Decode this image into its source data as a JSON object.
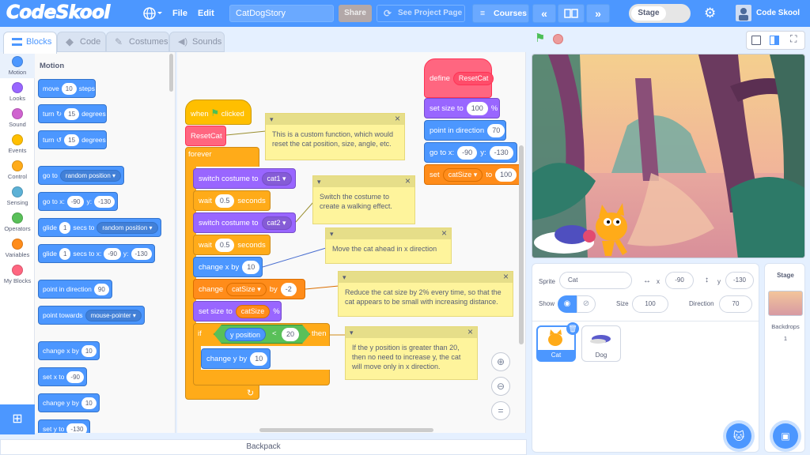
{
  "menubar": {
    "logo": "CodeSkool",
    "file": "File",
    "edit": "Edit",
    "project_title": "CatDogStory",
    "share": "Share",
    "see_project_page": "See Project Page",
    "courses": "Courses",
    "stage_toggle": "Stage",
    "user": "Code Skool"
  },
  "tabs": {
    "blocks": "Blocks",
    "code": "Code",
    "costumes": "Costumes",
    "sounds": "Sounds"
  },
  "categories": [
    {
      "label": "Motion",
      "color": "#4c97ff"
    },
    {
      "label": "Looks",
      "color": "#9966ff"
    },
    {
      "label": "Sound",
      "color": "#cf63cf"
    },
    {
      "label": "Events",
      "color": "#ffbf00"
    },
    {
      "label": "Control",
      "color": "#ffab19"
    },
    {
      "label": "Sensing",
      "color": "#5cb1d6"
    },
    {
      "label": "Operators",
      "color": "#59c059"
    },
    {
      "label": "Variables",
      "color": "#ff8c1a"
    },
    {
      "label": "My Blocks",
      "color": "#ff6680"
    }
  ],
  "palette": {
    "heading": "Motion",
    "move": {
      "a": "move",
      "v": "10",
      "b": "steps"
    },
    "turn_right": {
      "a": "turn",
      "v": "15",
      "b": "degrees"
    },
    "turn_left": {
      "a": "turn",
      "v": "15",
      "b": "degrees"
    },
    "goto": {
      "a": "go to",
      "v": "random position"
    },
    "goto_xy": {
      "a": "go to x:",
      "x": "-90",
      "b": "y:",
      "y": "-130"
    },
    "glide_to": {
      "a": "glide",
      "v": "1",
      "b": "secs to",
      "c": "random position"
    },
    "glide_xy": {
      "a": "glide",
      "v": "1",
      "b": "secs to x:",
      "x": "-90",
      "c": "y:",
      "y": "-130"
    },
    "point_dir": {
      "a": "point in direction",
      "v": "90"
    },
    "point_towards": {
      "a": "point towards",
      "v": "mouse-pointer"
    },
    "change_x": {
      "a": "change x by",
      "v": "10"
    },
    "set_x": {
      "a": "set x to",
      "v": "-90"
    },
    "change_y": {
      "a": "change y by",
      "v": "10"
    },
    "set_y": {
      "a": "set y to",
      "v": "-130"
    }
  },
  "script": {
    "when_flag": {
      "a": "when",
      "b": "clicked"
    },
    "reset_cat": "ResetCat",
    "forever": "forever",
    "switch1": {
      "a": "switch costume to",
      "v": "cat1"
    },
    "wait1": {
      "a": "wait",
      "v": "0.5",
      "b": "seconds"
    },
    "switch2": {
      "a": "switch costume to",
      "v": "cat2"
    },
    "wait2": {
      "a": "wait",
      "v": "0.5",
      "b": "seconds"
    },
    "change_x": {
      "a": "change x by",
      "v": "10"
    },
    "change_var": {
      "a": "change",
      "v": "catSize",
      "b": "by",
      "n": "-2"
    },
    "set_size": {
      "a": "set size to",
      "v": "catSize",
      "b": "%"
    },
    "if": {
      "a": "if",
      "lhs": "y position",
      "op": "<",
      "rhs": "20",
      "b": "then"
    },
    "change_y": {
      "a": "change y by",
      "v": "10"
    },
    "define": {
      "a": "define",
      "v": "ResetCat"
    },
    "def_set_size": {
      "a": "set size to",
      "v": "100",
      "b": "%"
    },
    "def_point": {
      "a": "point in direction",
      "v": "70"
    },
    "def_goto": {
      "a": "go to x:",
      "x": "-90",
      "b": "y:",
      "y": "-130"
    },
    "def_set_var": {
      "a": "set",
      "v": "catSize",
      "b": "to",
      "n": "100"
    }
  },
  "notes": {
    "n1": "This is a custom function, which would reset the cat position, size, angle, etc.",
    "n2": "Switch the costume to create a walking effect.",
    "n3": "Move the cat ahead in x direction",
    "n4": "Reduce the cat size by 2% every time, so that the cat appears to be small with increasing distance.",
    "n5": "If the y position is greater than 20, then no need to increase y, the cat will move only in x direction."
  },
  "sprite_info": {
    "sprite_label": "Sprite",
    "sprite_name": "Cat",
    "x_label": "x",
    "x": "-90",
    "y_label": "y",
    "y": "-130",
    "show_label": "Show",
    "size_label": "Size",
    "size": "100",
    "direction_label": "Direction",
    "direction": "70"
  },
  "sprites": [
    {
      "name": "Cat"
    },
    {
      "name": "Dog"
    }
  ],
  "stage_pane": {
    "title": "Stage",
    "backdrops_label": "Backdrops",
    "backdrops_count": "1"
  },
  "backpack": "Backpack"
}
